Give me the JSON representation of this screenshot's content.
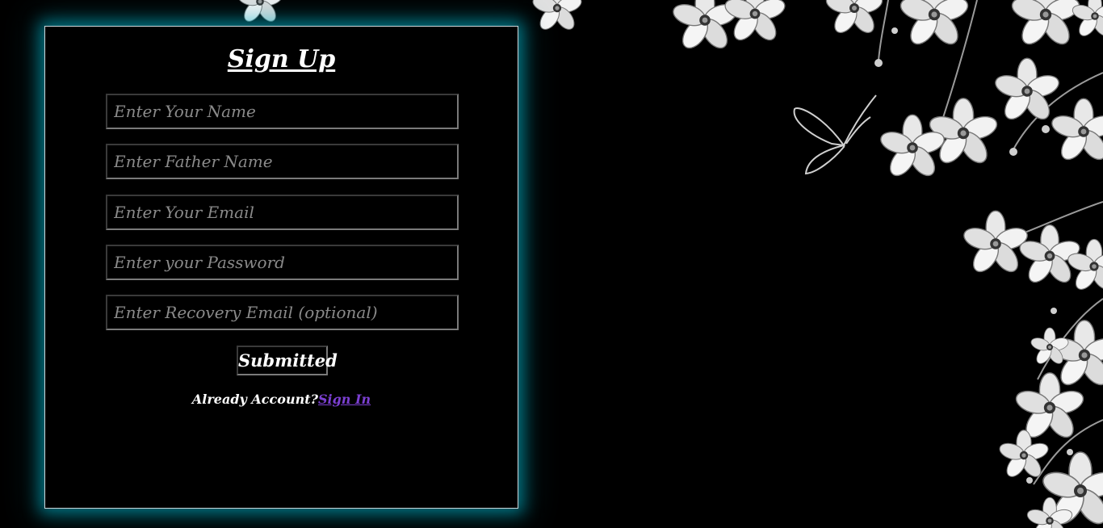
{
  "form": {
    "title": "Sign Up",
    "fields": [
      {
        "name": "name-input",
        "placeholder": "Enter Your Name",
        "value": ""
      },
      {
        "name": "father-name-input",
        "placeholder": "Enter Father Name",
        "value": ""
      },
      {
        "name": "email-input",
        "placeholder": "Enter Your Email",
        "value": ""
      },
      {
        "name": "password-input",
        "placeholder": "Enter your Password",
        "value": ""
      },
      {
        "name": "recovery-email-input",
        "placeholder": "Enter Recovery Email (optional)",
        "value": ""
      }
    ],
    "submit_label": "Submitted",
    "already_text": "Already Account?",
    "signin_label": "Sign In"
  },
  "theme": {
    "background": "#000000",
    "glow": "#00bcd4",
    "link": "#7b3fd1",
    "text": "#ffffff"
  },
  "background_art": {
    "description_icons": [
      "flower-icon",
      "butterfly-icon"
    ]
  }
}
